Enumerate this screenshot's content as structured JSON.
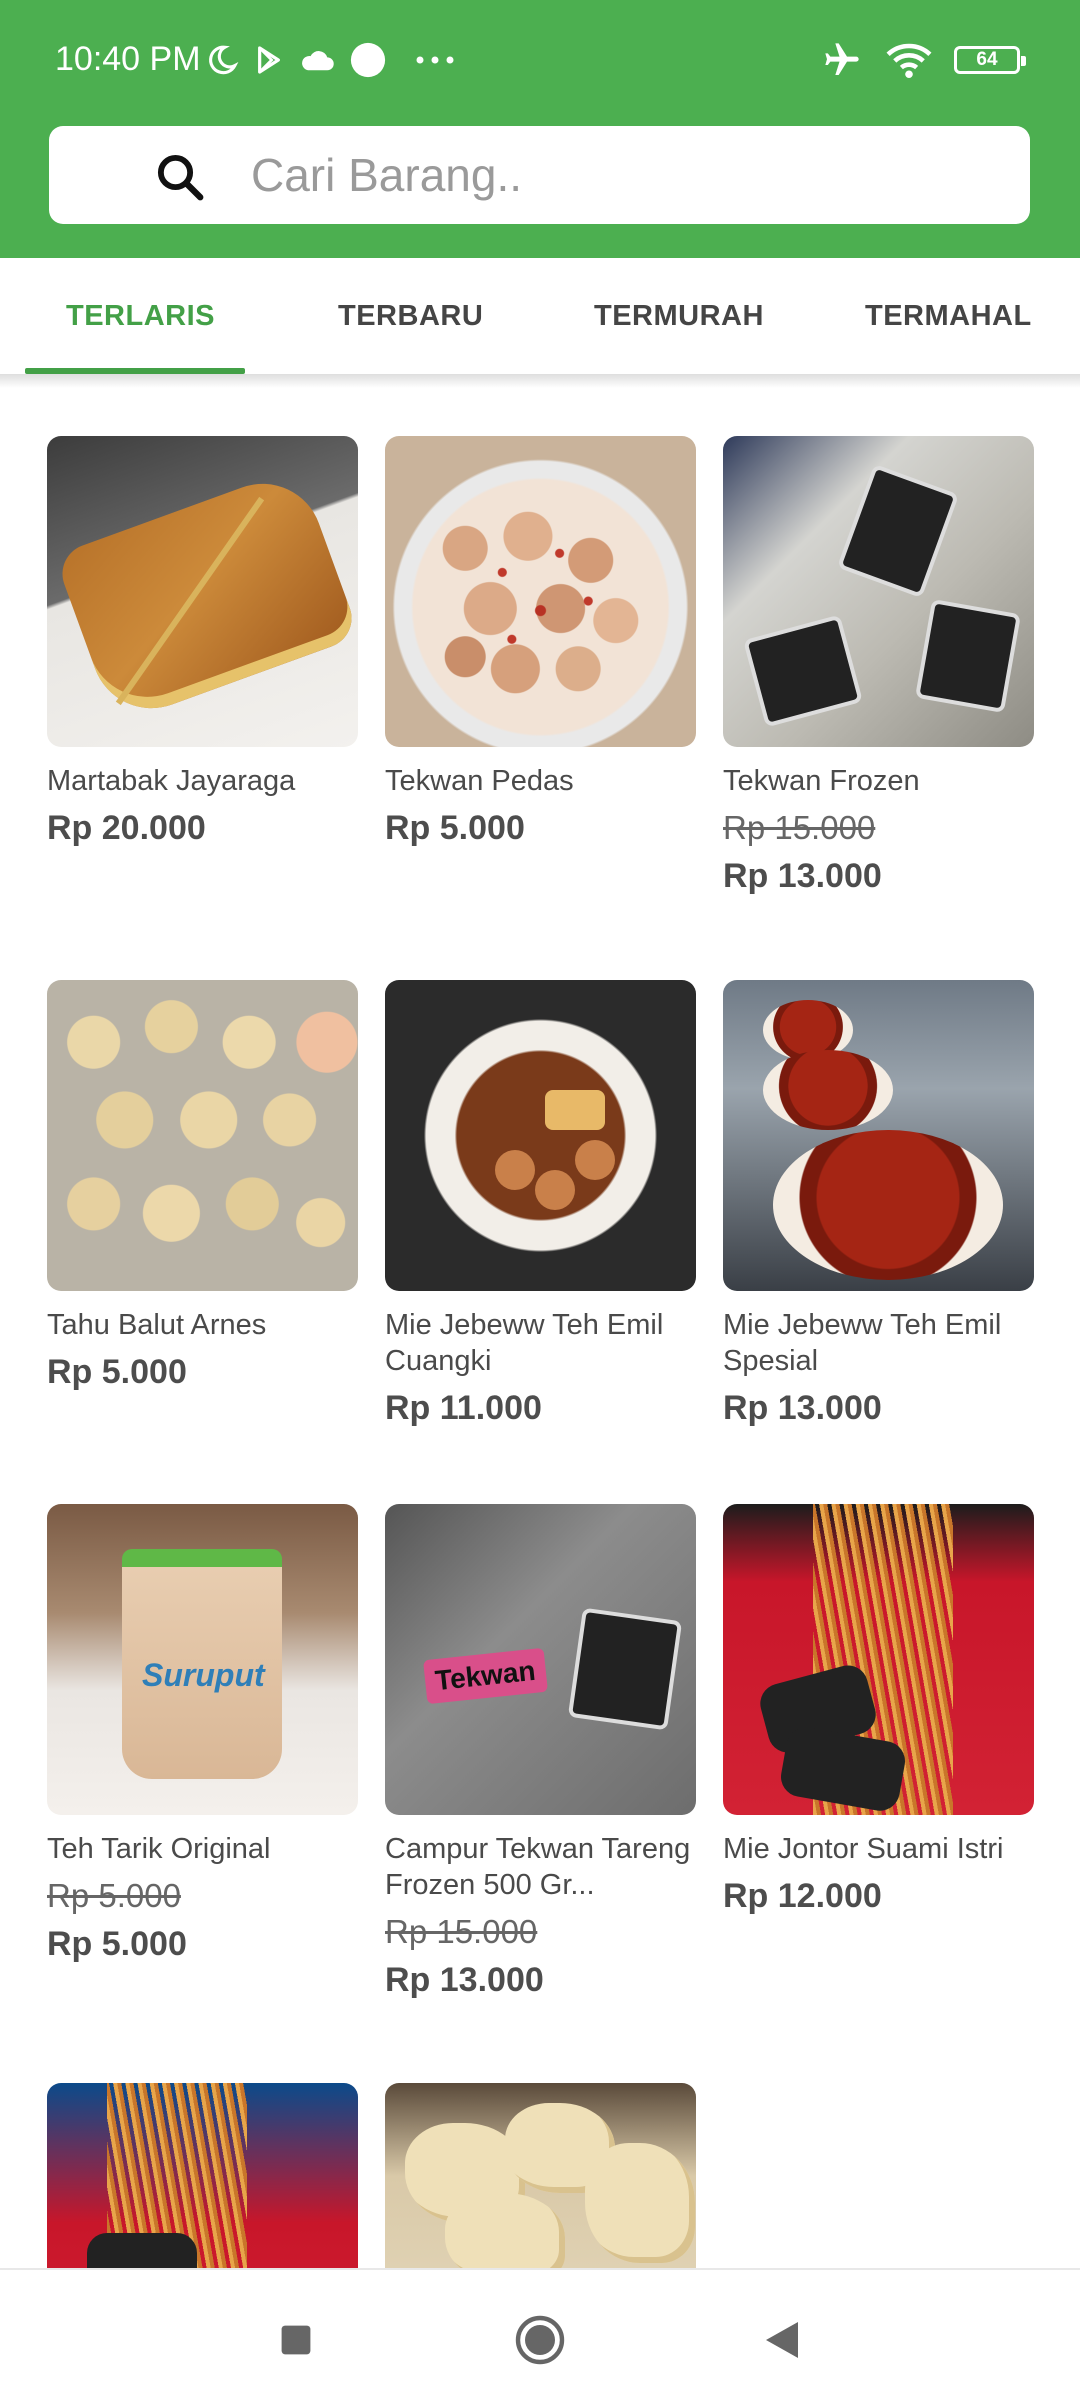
{
  "status_bar": {
    "time": "10:40 PM",
    "battery": "64",
    "left_icons": [
      "moon-icon",
      "play-store-icon",
      "cloud-icon",
      "circle-icon",
      "more-icon"
    ],
    "right_icons": [
      "airplane-icon",
      "wifi-icon",
      "battery-icon"
    ]
  },
  "search": {
    "placeholder": "Cari Barang.."
  },
  "tabs": [
    {
      "label": "TERLARIS",
      "active": true
    },
    {
      "label": "TERBARU",
      "active": false
    },
    {
      "label": "TERMURAH",
      "active": false
    },
    {
      "label": "TERMAHAL",
      "active": false
    }
  ],
  "products": [
    {
      "name": "Martabak Jayaraga",
      "old_price": "",
      "price": "Rp 20.000"
    },
    {
      "name": "Tekwan Pedas",
      "old_price": "",
      "price": "Rp 5.000"
    },
    {
      "name": "Tekwan Frozen",
      "old_price": "Rp 15.000",
      "price": "Rp 13.000"
    },
    {
      "name": "Tahu Balut Arnes",
      "old_price": "",
      "price": "Rp 5.000"
    },
    {
      "name": "Mie Jebeww Teh Emil Cuangki",
      "old_price": "",
      "price": "Rp 11.000"
    },
    {
      "name": "Mie Jebeww Teh Emil Spesial",
      "old_price": "",
      "price": "Rp 13.000"
    },
    {
      "name": "Teh Tarik Original",
      "old_price": "Rp 5.000",
      "price": "Rp 5.000"
    },
    {
      "name": "Campur Tekwan Tareng Frozen 500 Gr...",
      "old_price": "Rp 15.000",
      "price": "Rp 13.000"
    },
    {
      "name": "Mie Jontor Suami Istri",
      "old_price": "",
      "price": "Rp 12.000"
    },
    {
      "name": "",
      "old_price": "",
      "price": ""
    },
    {
      "name": "",
      "old_price": "",
      "price": ""
    }
  ],
  "image_text": {
    "teh_tarik_logo": "Suruput",
    "campur_label": "Tekwan"
  },
  "colors": {
    "primary": "#4caf50",
    "tab_active": "#43a047"
  },
  "navbar": [
    "recents-square-icon",
    "home-circle-icon",
    "back-triangle-icon"
  ]
}
